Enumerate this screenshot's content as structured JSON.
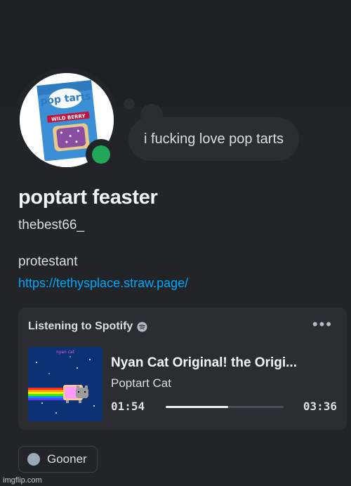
{
  "profile": {
    "display_name": "poptart feaster",
    "username": "thebest66_",
    "status_text": "i fucking love pop tarts",
    "bio": "protestant",
    "link": "https://tethysplace.straw.page/",
    "avatar": {
      "brand": "pop tarts",
      "flavor": "WILD BERRY"
    },
    "online_status": "online",
    "status_color": "#23a55a"
  },
  "activity": {
    "header": "Listening to Spotify",
    "icon": "spotify-icon",
    "more_icon": "more-icon",
    "track_title": "Nyan Cat Original! the Origi...",
    "artist": "Poptart Cat",
    "album_art_text": "nyan cat",
    "elapsed": "01:54",
    "total": "03:36",
    "progress_fraction": 0.53
  },
  "roles": [
    {
      "name": "Gooner",
      "color": "#99aab5"
    }
  ],
  "watermark": "imgflip.com",
  "colors": {
    "background": "#232428",
    "banner": "#1e1f22",
    "panel": "#2b2d31",
    "link": "#00a8fc"
  }
}
